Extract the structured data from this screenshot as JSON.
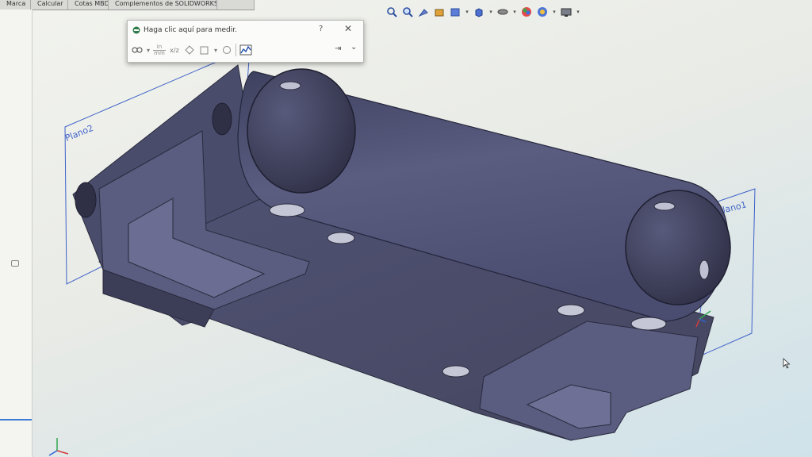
{
  "tabs": [
    "Marca",
    "Calcular",
    "Cotas MBD",
    "Complementos de SOLIDWORKS"
  ],
  "measure": {
    "title": "Haga clic aquí para medir.",
    "help": "?",
    "close": "✕",
    "units_top": "in",
    "units_bottom": "mm",
    "icons": [
      "measure-arc-icon",
      "units-icon",
      "xyz-icon",
      "point-icon",
      "projection-icon",
      "history-icon",
      "sensor-icon"
    ]
  },
  "viewport": {
    "plane_left": "Plano2",
    "plane_right": "Plano1"
  },
  "heads_up_icons": [
    "zoom-to-fit-icon",
    "zoom-area-icon",
    "previous-view-icon",
    "section-view-icon",
    "dynamic-annotation-icon",
    "view-orientation-icon",
    "display-style-icon",
    "hide-show-items-icon",
    "edit-appearance-icon",
    "apply-scene-icon",
    "view-settings-icon"
  ],
  "colors": {
    "part": "#4e5074",
    "plane": "#3f62c8",
    "selection": "#3b7bd6"
  }
}
